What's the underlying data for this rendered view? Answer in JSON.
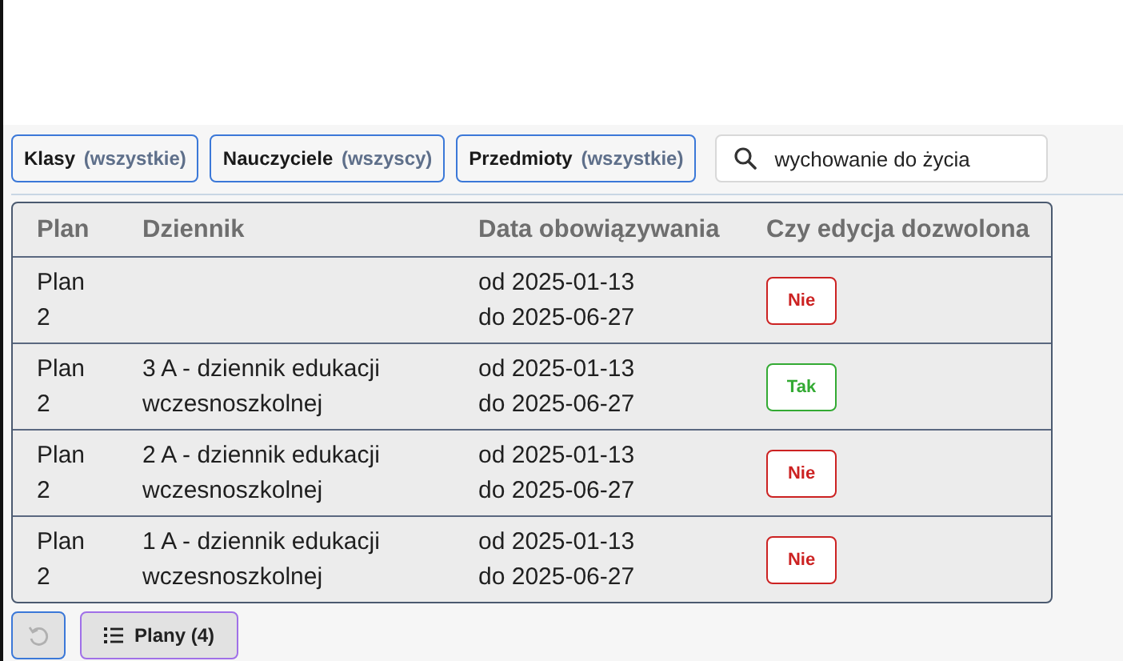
{
  "filters": [
    {
      "label": "Klasy",
      "value": "(wszystkie)"
    },
    {
      "label": "Nauczyciele",
      "value": "(wszyscy)"
    },
    {
      "label": "Przedmioty",
      "value": "(wszystkie)"
    }
  ],
  "search": {
    "value": "wychowanie do życia"
  },
  "table": {
    "columns": [
      "Plan",
      "Dziennik",
      "Data obowiązywania",
      "Czy edycja dozwolona"
    ],
    "rows": [
      {
        "plan": "Plan 2",
        "journal": "",
        "from": "od 2025-01-13",
        "to": "do 2025-06-27",
        "edit": {
          "label": "Nie",
          "allowed": false
        }
      },
      {
        "plan": "Plan 2",
        "journal": "3 A - dziennik edukacji wczesnoszkolnej",
        "from": "od 2025-01-13",
        "to": "do 2025-06-27",
        "edit": {
          "label": "Tak",
          "allowed": true
        }
      },
      {
        "plan": "Plan 2",
        "journal": "2 A - dziennik edukacji wczesnoszkolnej",
        "from": "od 2025-01-13",
        "to": "do 2025-06-27",
        "edit": {
          "label": "Nie",
          "allowed": false
        }
      },
      {
        "plan": "Plan 2",
        "journal": "1 A - dziennik edukacji wczesnoszkolnej",
        "from": "od 2025-01-13",
        "to": "do 2025-06-27",
        "edit": {
          "label": "Nie",
          "allowed": false
        }
      }
    ]
  },
  "footer": {
    "undo": {
      "disabled": true
    },
    "plans_button": "Plany (4)"
  }
}
